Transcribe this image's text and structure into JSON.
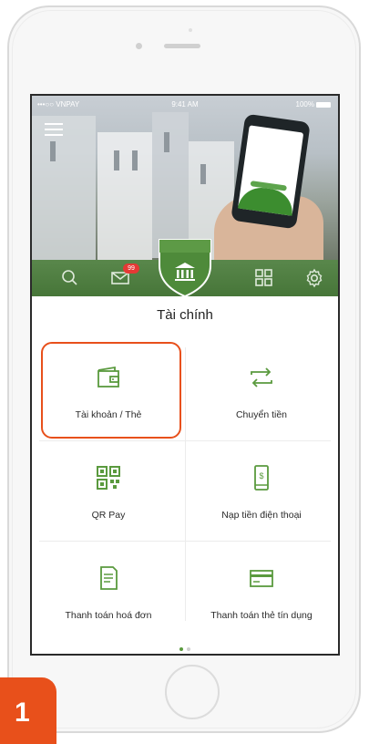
{
  "status_bar": {
    "carrier": "•••○○ VNPAY",
    "time": "9:41 AM",
    "battery": "100%"
  },
  "nav": {
    "items": [
      {
        "name": "search",
        "icon": "search-icon"
      },
      {
        "name": "messages",
        "icon": "mail-icon",
        "badge": "99"
      },
      {
        "name": "finance",
        "icon": "bank-icon",
        "active": true
      },
      {
        "name": "apps",
        "icon": "grid-icon"
      },
      {
        "name": "settings",
        "icon": "gear-icon"
      }
    ]
  },
  "section": {
    "title": "Tài chính"
  },
  "tiles": [
    {
      "label": "Tài khoản / Thẻ",
      "icon": "wallet-icon",
      "highlighted": true
    },
    {
      "label": "Chuyển tiền",
      "icon": "transfer-icon"
    },
    {
      "label": "QR Pay",
      "icon": "qr-code-icon"
    },
    {
      "label": "Nạp tiền điện thoại",
      "icon": "phone-topup-icon"
    },
    {
      "label": "Thanh toán hoá đơn",
      "icon": "bill-icon"
    },
    {
      "label": "Thanh toán thẻ tín dụng",
      "icon": "credit-card-icon"
    }
  ],
  "pager": {
    "pages": 2,
    "current": 1
  },
  "step": {
    "number": "1"
  },
  "colors": {
    "brand_green": "#4b7d3c",
    "icon_green": "#5a9a3e",
    "highlight": "#e8501b"
  }
}
